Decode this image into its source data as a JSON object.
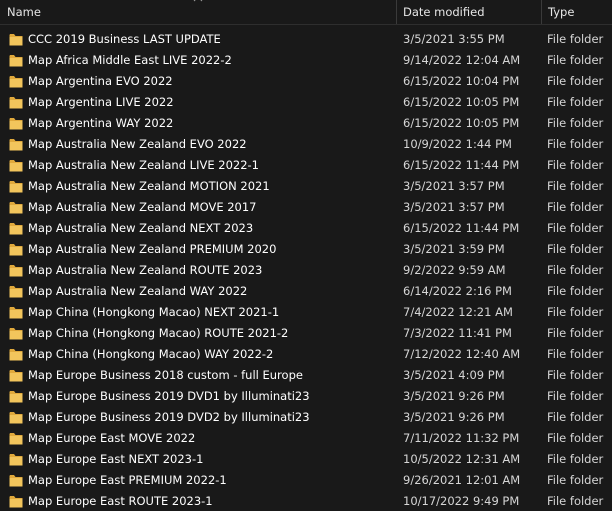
{
  "columns": {
    "name": "Name",
    "date": "Date modified",
    "type": "Type"
  },
  "colors": {
    "background": "#191919",
    "folder": "#e8b64a"
  },
  "files": [
    {
      "name": "CCC 2019 Business LAST UPDATE",
      "date": "3/5/2021 3:55 PM",
      "type": "File folder"
    },
    {
      "name": "Map Africa Middle East LIVE 2022-2",
      "date": "9/14/2022 12:04 AM",
      "type": "File folder"
    },
    {
      "name": "Map Argentina EVO 2022",
      "date": "6/15/2022 10:04 PM",
      "type": "File folder"
    },
    {
      "name": "Map Argentina LIVE 2022",
      "date": "6/15/2022 10:05 PM",
      "type": "File folder"
    },
    {
      "name": "Map Argentina WAY 2022",
      "date": "6/15/2022 10:05 PM",
      "type": "File folder"
    },
    {
      "name": "Map Australia New Zealand EVO 2022",
      "date": "10/9/2022 1:44 PM",
      "type": "File folder"
    },
    {
      "name": "Map Australia New Zealand LIVE 2022-1",
      "date": "6/15/2022 11:44 PM",
      "type": "File folder"
    },
    {
      "name": "Map Australia New Zealand MOTION 2021",
      "date": "3/5/2021 3:57 PM",
      "type": "File folder"
    },
    {
      "name": "Map Australia New Zealand MOVE 2017",
      "date": "3/5/2021 3:57 PM",
      "type": "File folder"
    },
    {
      "name": "Map Australia New Zealand NEXT 2023",
      "date": "6/15/2022 11:44 PM",
      "type": "File folder"
    },
    {
      "name": "Map Australia New Zealand PREMIUM 2020",
      "date": "3/5/2021 3:59 PM",
      "type": "File folder"
    },
    {
      "name": "Map Australia New Zealand ROUTE 2023",
      "date": "9/2/2022 9:59 AM",
      "type": "File folder"
    },
    {
      "name": "Map Australia New Zealand WAY 2022",
      "date": "6/14/2022 2:16 PM",
      "type": "File folder"
    },
    {
      "name": "Map China (Hongkong Macao) NEXT 2021-1",
      "date": "7/4/2022 12:21 AM",
      "type": "File folder"
    },
    {
      "name": "Map China (Hongkong Macao) ROUTE 2021-2",
      "date": "7/3/2022 11:41 PM",
      "type": "File folder"
    },
    {
      "name": "Map China (Hongkong Macao) WAY 2022-2",
      "date": "7/12/2022 12:40 AM",
      "type": "File folder"
    },
    {
      "name": "Map Europe Business 2018 custom - full Europe",
      "date": "3/5/2021 4:09 PM",
      "type": "File folder"
    },
    {
      "name": "Map Europe Business 2019 DVD1 by Illuminati23",
      "date": "3/5/2021 9:26 PM",
      "type": "File folder"
    },
    {
      "name": "Map Europe Business 2019 DVD2 by Illuminati23",
      "date": "3/5/2021 9:26 PM",
      "type": "File folder"
    },
    {
      "name": "Map Europe East MOVE 2022",
      "date": "7/11/2022 11:32 PM",
      "type": "File folder"
    },
    {
      "name": "Map Europe East NEXT 2023-1",
      "date": "10/5/2022 12:31 AM",
      "type": "File folder"
    },
    {
      "name": "Map Europe East PREMIUM 2022-1",
      "date": "9/26/2021 12:01 AM",
      "type": "File folder"
    },
    {
      "name": "Map Europe East ROUTE 2023-1",
      "date": "10/17/2022 9:49 PM",
      "type": "File folder"
    }
  ]
}
